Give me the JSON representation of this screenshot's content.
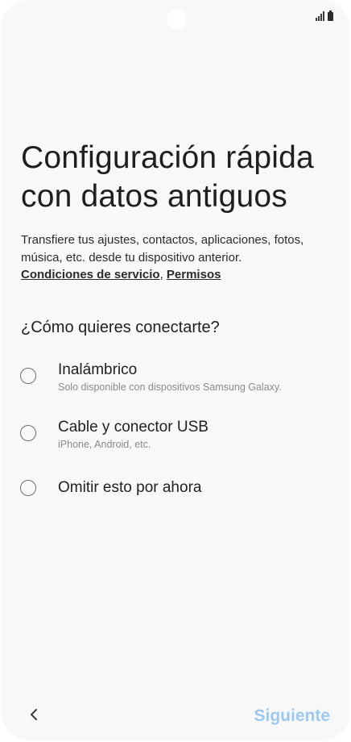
{
  "title": "Configuración rápida con datos antiguos",
  "description": "Transfiere tus ajustes, contactos, aplicaciones, fotos, música, etc. desde tu dispositivo anterior.",
  "links": {
    "terms": "Condiciones de servicio",
    "separator": ", ",
    "permissions": "Permisos"
  },
  "question": "¿Cómo quieres conectarte?",
  "options": [
    {
      "label": "Inalámbrico",
      "sub": "Solo disponible con dispositivos Samsung Galaxy."
    },
    {
      "label": "Cable y conector USB",
      "sub": "iPhone, Android, etc."
    },
    {
      "label": "Omitir esto por ahora",
      "sub": ""
    }
  ],
  "footer": {
    "back_icon": "chevron-left-icon",
    "next_label": "Siguiente",
    "next_color": "#9cc9f2"
  }
}
